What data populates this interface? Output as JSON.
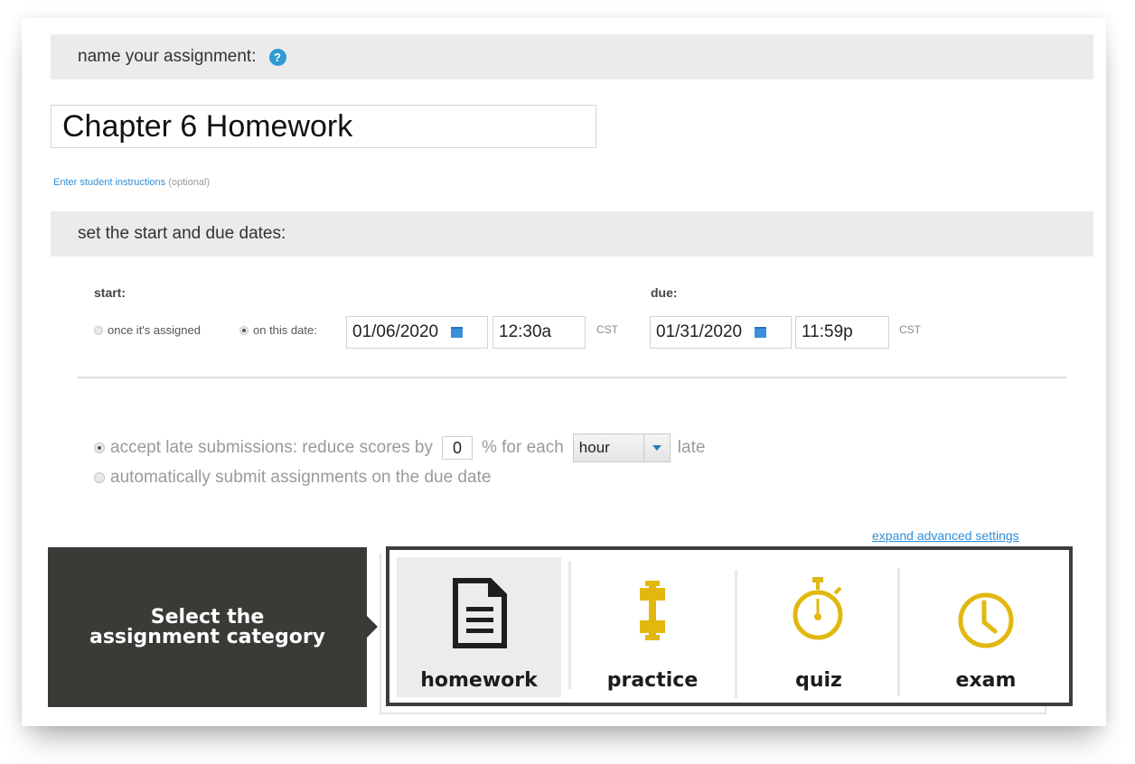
{
  "name_section": {
    "heading": "name your assignment:",
    "help_icon": "?",
    "assignment_name": "Chapter 6 Homework",
    "instructions_link": "Enter student instructions",
    "instructions_optional": "(optional)"
  },
  "dates_section": {
    "heading": "set the start and due dates:",
    "start": {
      "label": "start:",
      "option_assigned": "once it's assigned",
      "option_date": "on this date:",
      "selected": "on this date:",
      "date": "01/06/2020",
      "time": "12:30a",
      "timezone": "CST"
    },
    "due": {
      "label": "due:",
      "date": "01/31/2020",
      "time": "11:59p",
      "timezone": "CST"
    }
  },
  "late_section": {
    "accept_label_before": "accept late submissions: reduce scores by",
    "reduce_percent": "0",
    "accept_label_middle": "% for each",
    "period": "hour",
    "accept_label_after": "late",
    "auto_submit_label": "automatically submit assignments on the due date",
    "selected": "accept"
  },
  "expand_link": "expand advanced settings",
  "callout": {
    "line1": "Select the",
    "line2": "assignment category"
  },
  "categories": {
    "selected": "homework",
    "items": [
      {
        "label": "homework",
        "icon": "document-icon",
        "color": "#1e1e1e"
      },
      {
        "label": "practice",
        "icon": "dumbbell-icon",
        "color": "#e2b80f"
      },
      {
        "label": "quiz",
        "icon": "stopwatch-icon",
        "color": "#e2b80f"
      },
      {
        "label": "exam",
        "icon": "clock-icon",
        "color": "#e2b80f"
      }
    ]
  },
  "colors": {
    "link": "#2f8fd9",
    "accent_yellow": "#e2b80f",
    "callout_bg": "#3a3b37",
    "section_bg": "#ebebeb"
  }
}
